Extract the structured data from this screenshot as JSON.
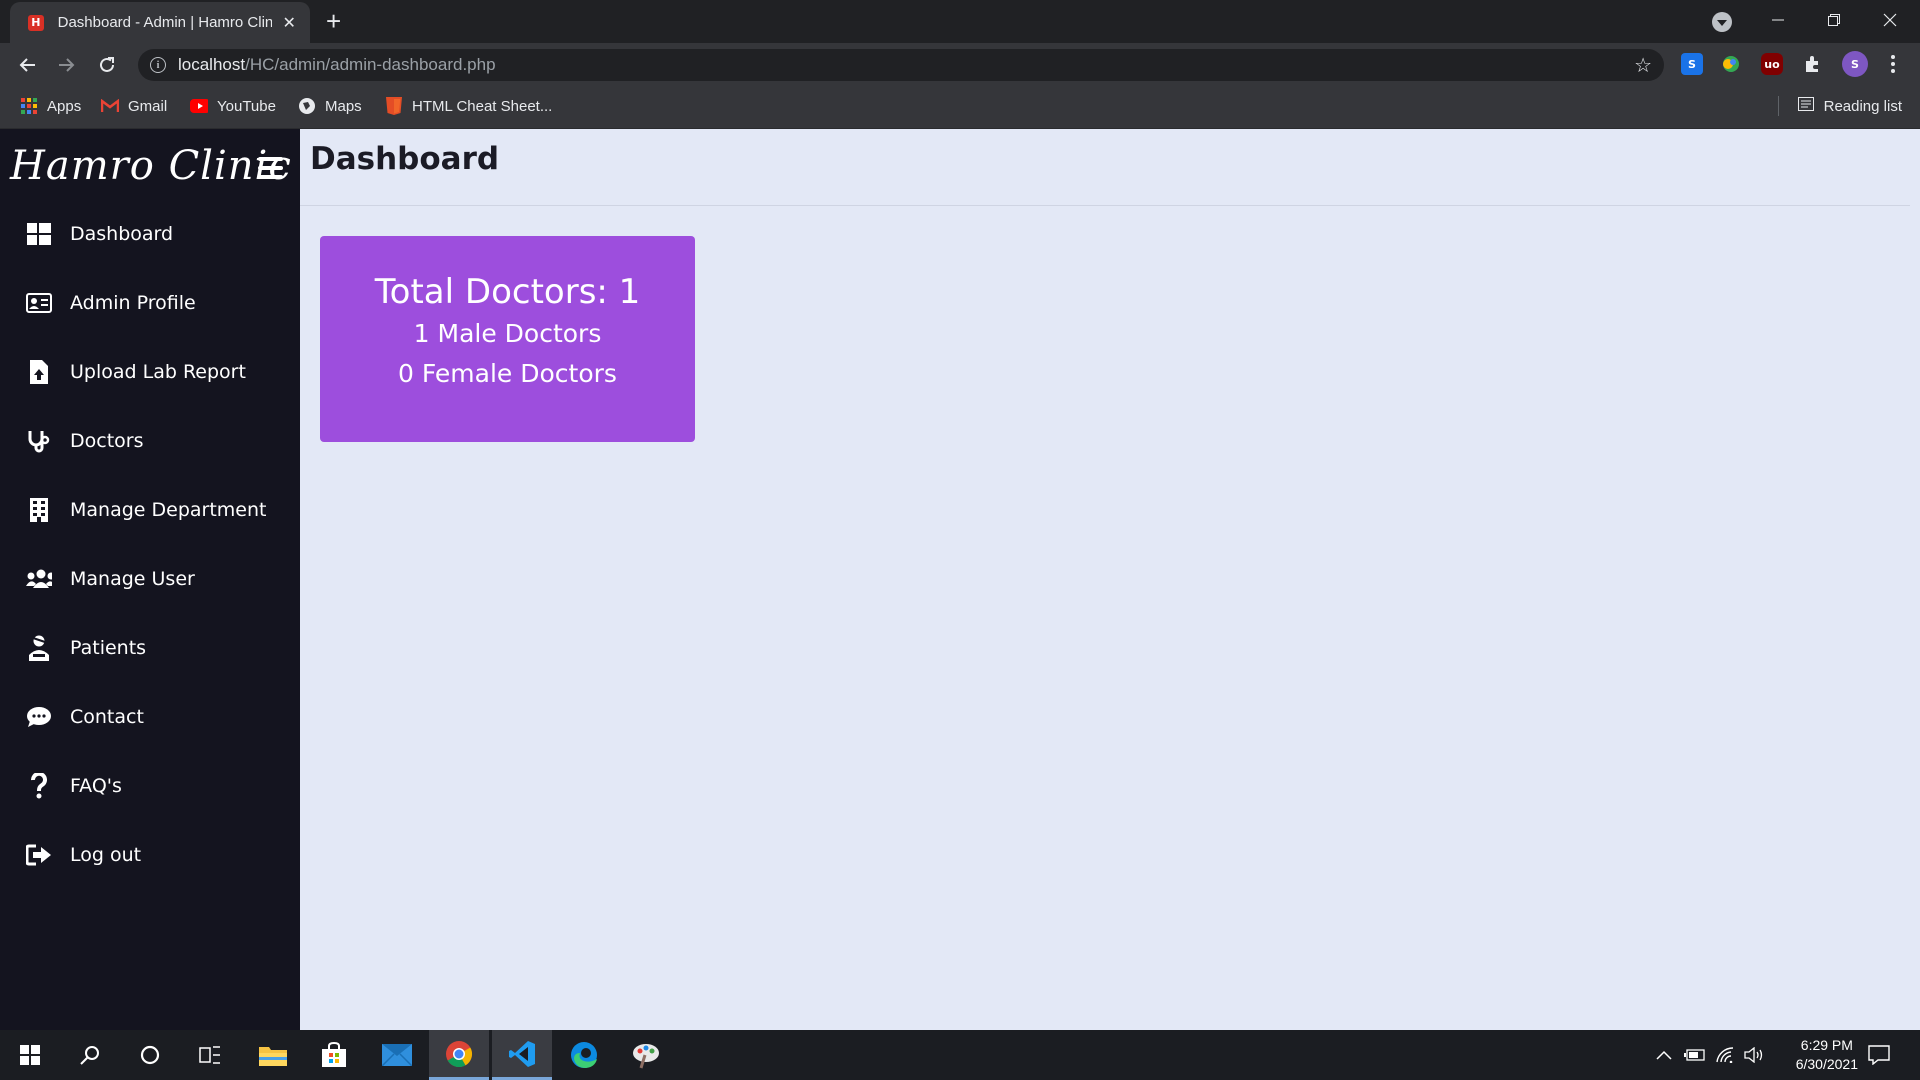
{
  "browser": {
    "tab_title": "Dashboard - Admin | Hamro Clinic",
    "url_host": "localhost",
    "url_path": "/HC/admin/admin-dashboard.php",
    "bookmarks": [
      {
        "label": "Apps",
        "icon": "apps-grid-icon"
      },
      {
        "label": "Gmail",
        "icon": "gmail-icon"
      },
      {
        "label": "YouTube",
        "icon": "youtube-icon"
      },
      {
        "label": "Maps",
        "icon": "maps-icon"
      },
      {
        "label": "HTML Cheat Sheet...",
        "icon": "html5-icon"
      }
    ],
    "reading_list": "Reading list",
    "profile_initial": "S"
  },
  "sidebar": {
    "brand": "Hamro Clinic",
    "items": [
      {
        "label": "Dashboard",
        "icon": "dashboard-grid-icon"
      },
      {
        "label": "Admin Profile",
        "icon": "id-card-icon"
      },
      {
        "label": "Upload Lab Report",
        "icon": "file-upload-icon"
      },
      {
        "label": "Doctors",
        "icon": "stethoscope-icon"
      },
      {
        "label": "Manage Department",
        "icon": "building-icon"
      },
      {
        "label": "Manage User",
        "icon": "users-icon"
      },
      {
        "label": "Patients",
        "icon": "user-injured-icon"
      },
      {
        "label": "Contact",
        "icon": "comment-dots-icon"
      },
      {
        "label": "FAQ's",
        "icon": "question-icon"
      },
      {
        "label": "Log out",
        "icon": "sign-out-icon"
      }
    ]
  },
  "main": {
    "title": "Dashboard",
    "card": {
      "total": "Total Doctors: 1",
      "male": "1 Male Doctors",
      "female": "0 Female Doctors"
    }
  },
  "taskbar": {
    "time": "6:29 PM",
    "date": "6/30/2021"
  },
  "colors": {
    "sidebar_bg": "#14141f",
    "content_bg": "#e3e8f6",
    "card_bg": "#9d4edd"
  }
}
